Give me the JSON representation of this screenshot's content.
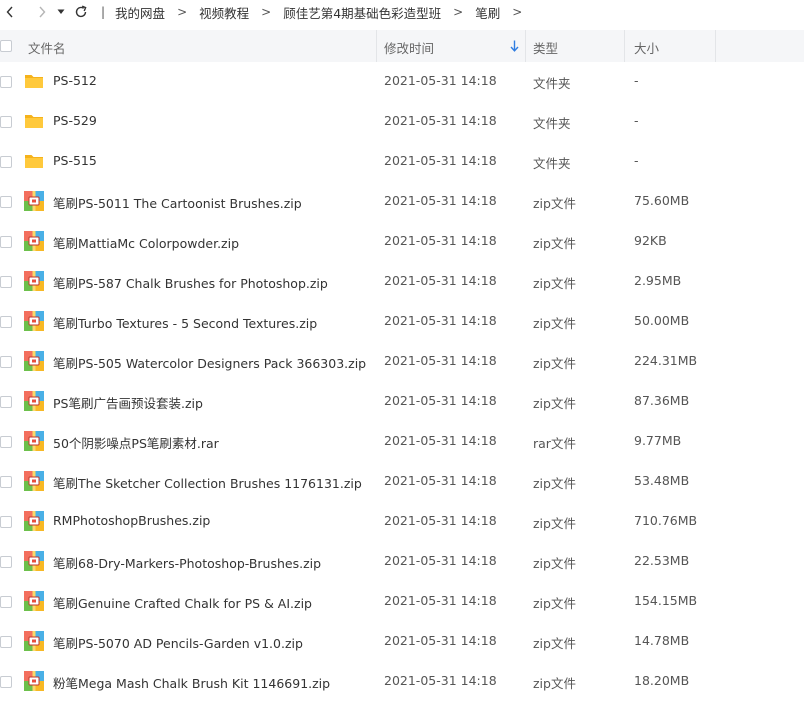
{
  "breadcrumb": [
    "我的网盘",
    "视频教程",
    "顾佳艺第4期基础色彩造型班",
    "笔刷"
  ],
  "columns": {
    "name": "文件名",
    "modified": "修改时间",
    "type": "类型",
    "size": "大小"
  },
  "colors": {
    "folder": "#ffc93c",
    "header_bg": "#f5f6f8",
    "sort_arrow": "#2f7de1"
  },
  "files": [
    {
      "name": "PS-512",
      "modified": "2021-05-31 14:18",
      "type": "文件夹",
      "size": "-",
      "icon": "folder-icon"
    },
    {
      "name": "PS-529",
      "modified": "2021-05-31 14:18",
      "type": "文件夹",
      "size": "-",
      "icon": "folder-icon"
    },
    {
      "name": "PS-515",
      "modified": "2021-05-31 14:18",
      "type": "文件夹",
      "size": "-",
      "icon": "folder-icon"
    },
    {
      "name": "笔刷PS-5011 The Cartoonist Brushes.zip",
      "modified": "2021-05-31 14:18",
      "type": "zip文件",
      "size": "75.60MB",
      "icon": "archive-icon"
    },
    {
      "name": "笔刷MattiaMc Colorpowder.zip",
      "modified": "2021-05-31 14:18",
      "type": "zip文件",
      "size": "92KB",
      "icon": "archive-icon"
    },
    {
      "name": "笔刷PS-587 Chalk Brushes for Photoshop.zip",
      "modified": "2021-05-31 14:18",
      "type": "zip文件",
      "size": "2.95MB",
      "icon": "archive-icon"
    },
    {
      "name": "笔刷Turbo Textures - 5 Second Textures.zip",
      "modified": "2021-05-31 14:18",
      "type": "zip文件",
      "size": "50.00MB",
      "icon": "archive-icon"
    },
    {
      "name": "笔刷PS-505 Watercolor Designers Pack 366303.zip",
      "modified": "2021-05-31 14:18",
      "type": "zip文件",
      "size": "224.31MB",
      "icon": "archive-icon"
    },
    {
      "name": "PS笔刷广告画预设套装.zip",
      "modified": "2021-05-31 14:18",
      "type": "zip文件",
      "size": "87.36MB",
      "icon": "archive-icon"
    },
    {
      "name": "50个阴影噪点PS笔刷素材.rar",
      "modified": "2021-05-31 14:18",
      "type": "rar文件",
      "size": "9.77MB",
      "icon": "archive-icon"
    },
    {
      "name": "笔刷The Sketcher Collection Brushes 1176131.zip",
      "modified": "2021-05-31 14:18",
      "type": "zip文件",
      "size": "53.48MB",
      "icon": "archive-icon"
    },
    {
      "name": "RMPhotoshopBrushes.zip",
      "modified": "2021-05-31 14:18",
      "type": "zip文件",
      "size": "710.76MB",
      "icon": "archive-icon"
    },
    {
      "name": "笔刷68-Dry-Markers-Photoshop-Brushes.zip",
      "modified": "2021-05-31 14:18",
      "type": "zip文件",
      "size": "22.53MB",
      "icon": "archive-icon"
    },
    {
      "name": "笔刷Genuine Crafted Chalk for PS & AI.zip",
      "modified": "2021-05-31 14:18",
      "type": "zip文件",
      "size": "154.15MB",
      "icon": "archive-icon"
    },
    {
      "name": "笔刷PS-5070 AD Pencils-Garden v1.0.zip",
      "modified": "2021-05-31 14:18",
      "type": "zip文件",
      "size": "14.78MB",
      "icon": "archive-icon"
    },
    {
      "name": "粉笔Mega Mash Chalk Brush Kit 1146691.zip",
      "modified": "2021-05-31 14:18",
      "type": "zip文件",
      "size": "18.20MB",
      "icon": "archive-icon"
    }
  ]
}
